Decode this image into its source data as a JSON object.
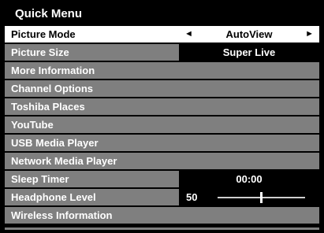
{
  "menu": {
    "title": "Quick Menu",
    "items": [
      {
        "label": "Picture Mode",
        "value": "AutoView",
        "selected": true
      },
      {
        "label": "Picture Size",
        "value": "Super Live"
      },
      {
        "label": "More Information"
      },
      {
        "label": "Channel Options"
      },
      {
        "label": "Toshiba Places"
      },
      {
        "label": "YouTube"
      },
      {
        "label": "USB Media Player"
      },
      {
        "label": "Network Media Player"
      },
      {
        "label": "Sleep Timer",
        "value": "00:00"
      },
      {
        "label": "Headphone Level",
        "value": "50",
        "level_fraction": 0.5
      },
      {
        "label": "Wireless Information"
      }
    ],
    "arrow_left": "◄",
    "arrow_right": "►"
  },
  "colors": {
    "background": "#000000",
    "row": "#7f7f7f",
    "selected_row": "#ffffff",
    "text": "#ffffff"
  }
}
